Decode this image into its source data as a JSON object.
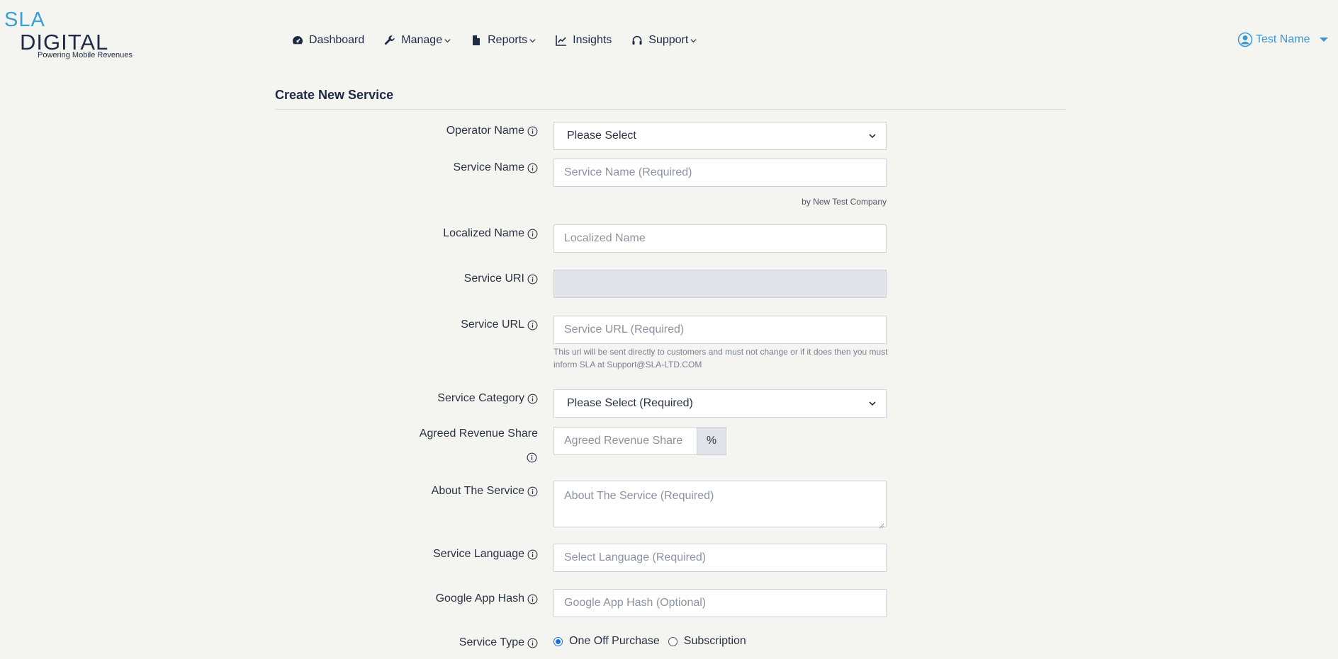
{
  "logo": {
    "line1": "SLA",
    "line2": "DIGITAL",
    "tagline": "Powering Mobile Revenues"
  },
  "nav": [
    {
      "label": "Dashboard",
      "icon": "dashboard-icon"
    },
    {
      "label": "Manage",
      "icon": "wrench-icon"
    },
    {
      "label": "Reports",
      "icon": "document-icon"
    },
    {
      "label": "Insights",
      "icon": "chart-line-icon"
    },
    {
      "label": "Support",
      "icon": "headset-icon"
    }
  ],
  "user": {
    "name": "Test Name",
    "icon": "user-circle-icon"
  },
  "page": {
    "title": "Create New Service"
  },
  "form": {
    "operator_name": {
      "label": "Operator Name",
      "value": "Please Select"
    },
    "service_name": {
      "label": "Service Name",
      "placeholder": "Service Name (Required)",
      "help": "by New Test Company"
    },
    "localized_name": {
      "label": "Localized Name",
      "placeholder": "Localized Name"
    },
    "service_uri": {
      "label": "Service URI",
      "value": ""
    },
    "service_url": {
      "label": "Service URL",
      "placeholder": "Service URL (Required)",
      "help_line1": "This url will be sent directly to customers and must not change or if it does then you must",
      "help_line2": "inform SLA at Support@SLA-LTD.COM"
    },
    "service_category": {
      "label": "Service Category",
      "value": "Please Select (Required)"
    },
    "revenue_share": {
      "label": "Agreed Revenue Share",
      "placeholder": "Agreed Revenue Share",
      "suffix": "%"
    },
    "about": {
      "label": "About The Service",
      "placeholder": "About The Service (Required)"
    },
    "language": {
      "label": "Service Language",
      "placeholder": "Select Language (Required)"
    },
    "app_hash": {
      "label": "Google App Hash",
      "placeholder": "Google App Hash (Optional)"
    },
    "service_type": {
      "label": "Service Type",
      "options": [
        "One Off Purchase",
        "Subscription"
      ],
      "selected": "One Off Purchase"
    }
  },
  "colors": {
    "accent": "#3a98d8",
    "text": "#1f2a44",
    "background": "#f4f4f1"
  }
}
